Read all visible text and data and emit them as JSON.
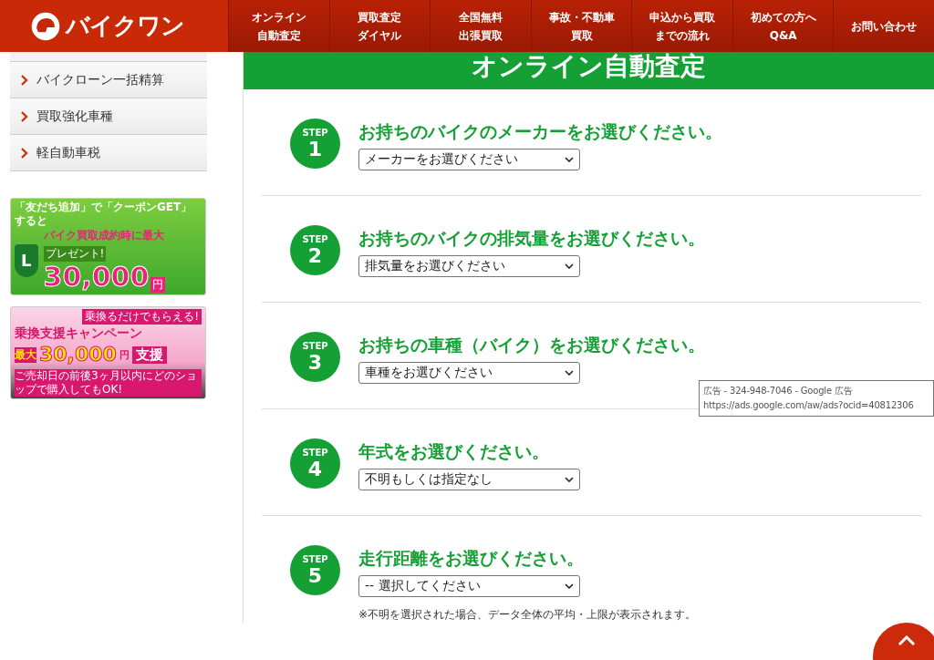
{
  "header": {
    "logo": "バイクワン",
    "nav": [
      {
        "lines": [
          "オンライン",
          "自動査定"
        ]
      },
      {
        "lines": [
          "買取査定",
          "ダイヤル"
        ]
      },
      {
        "lines": [
          "全国無料",
          "出張買取"
        ]
      },
      {
        "lines": [
          "事故・不動車",
          "買取"
        ]
      },
      {
        "lines": [
          "申込から買取",
          "までの流れ"
        ]
      },
      {
        "lines": [
          "初めての方へ",
          "Q&A"
        ]
      },
      {
        "lines": [
          "お問い合わせ"
        ]
      }
    ]
  },
  "sidebar": {
    "items": [
      "バイクローン一括精算",
      "買取強化車種",
      "軽自動車税"
    ],
    "banners": [
      {
        "kind": "line",
        "top": "「友だち追加」で「クーポンGET」すると",
        "sub": "バイク買取成約時に最大",
        "tag": "プレゼント!",
        "badge": "L",
        "amount": "30,000",
        "unit": "円"
      },
      {
        "kind": "campaign",
        "top": "乗換支援キャンペーン",
        "tag": "乗換るだけでもらえる!",
        "prefix": "最大",
        "amount": "30,000",
        "unit": "円",
        "badge": "支援",
        "bottom": "ご売却日の前後3ヶ月以内にどのショップで購入してもOK!"
      }
    ]
  },
  "main": {
    "title": "オンライン自動査定",
    "steps": [
      {
        "label": "STEP",
        "number": "1",
        "heading": "お持ちのバイクのメーカーをお選びください。",
        "select": "メーカーをお選びください"
      },
      {
        "label": "STEP",
        "number": "2",
        "heading": "お持ちのバイクの排気量をお選びください。",
        "select": "排気量をお選びください"
      },
      {
        "label": "STEP",
        "number": "3",
        "heading": "お持ちの車種（バイク）をお選びください。",
        "select": "車種をお選びください"
      },
      {
        "label": "STEP",
        "number": "4",
        "heading": "年式をお選びください。",
        "select": "不明もしくは指定なし"
      },
      {
        "label": "STEP",
        "number": "5",
        "heading": "走行距離をお選びください。",
        "select": "-- 選択してください",
        "note": "※不明を選択された場合、データ全体の平均・上限が表示されます。"
      }
    ]
  },
  "tooltip": {
    "lines": [
      "広告 - 324-948-7046 - Google 広告",
      "https://ads.google.com/aw/ads?ocid=40812306"
    ]
  }
}
